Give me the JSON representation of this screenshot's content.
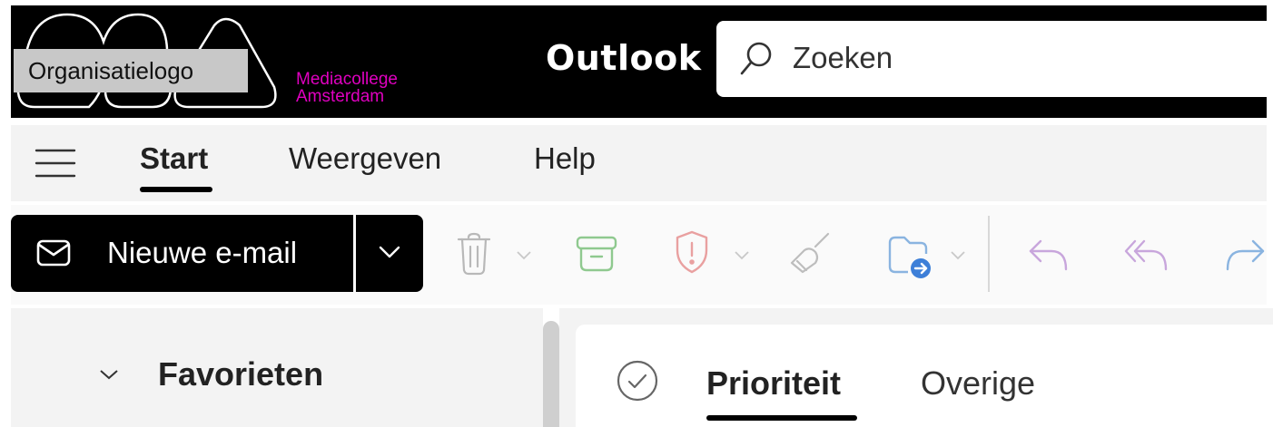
{
  "header": {
    "logo_label": "Organisatielogo",
    "brand_line1": "Mediacollege",
    "brand_line2": "Amsterdam",
    "app_title": "Outlook",
    "search_placeholder": "Zoeken"
  },
  "tabs": [
    {
      "label": "Start",
      "active": true
    },
    {
      "label": "Weergeven",
      "active": false
    },
    {
      "label": "Help",
      "active": false
    }
  ],
  "toolbar": {
    "new_mail_label": "Nieuwe e-mail",
    "icons": [
      "delete-icon",
      "archive-icon",
      "report-icon",
      "sweep-icon",
      "move-to-icon",
      "reply-icon",
      "reply-all-icon",
      "forward-icon"
    ]
  },
  "nav": {
    "favorites_label": "Favorieten"
  },
  "inbox_tabs": [
    {
      "label": "Prioriteit",
      "active": true
    },
    {
      "label": "Overige",
      "active": false
    }
  ],
  "colors": {
    "header_bg": "#000000",
    "brand": "#e000c0",
    "tabbar_bg": "#f3f3f3"
  }
}
